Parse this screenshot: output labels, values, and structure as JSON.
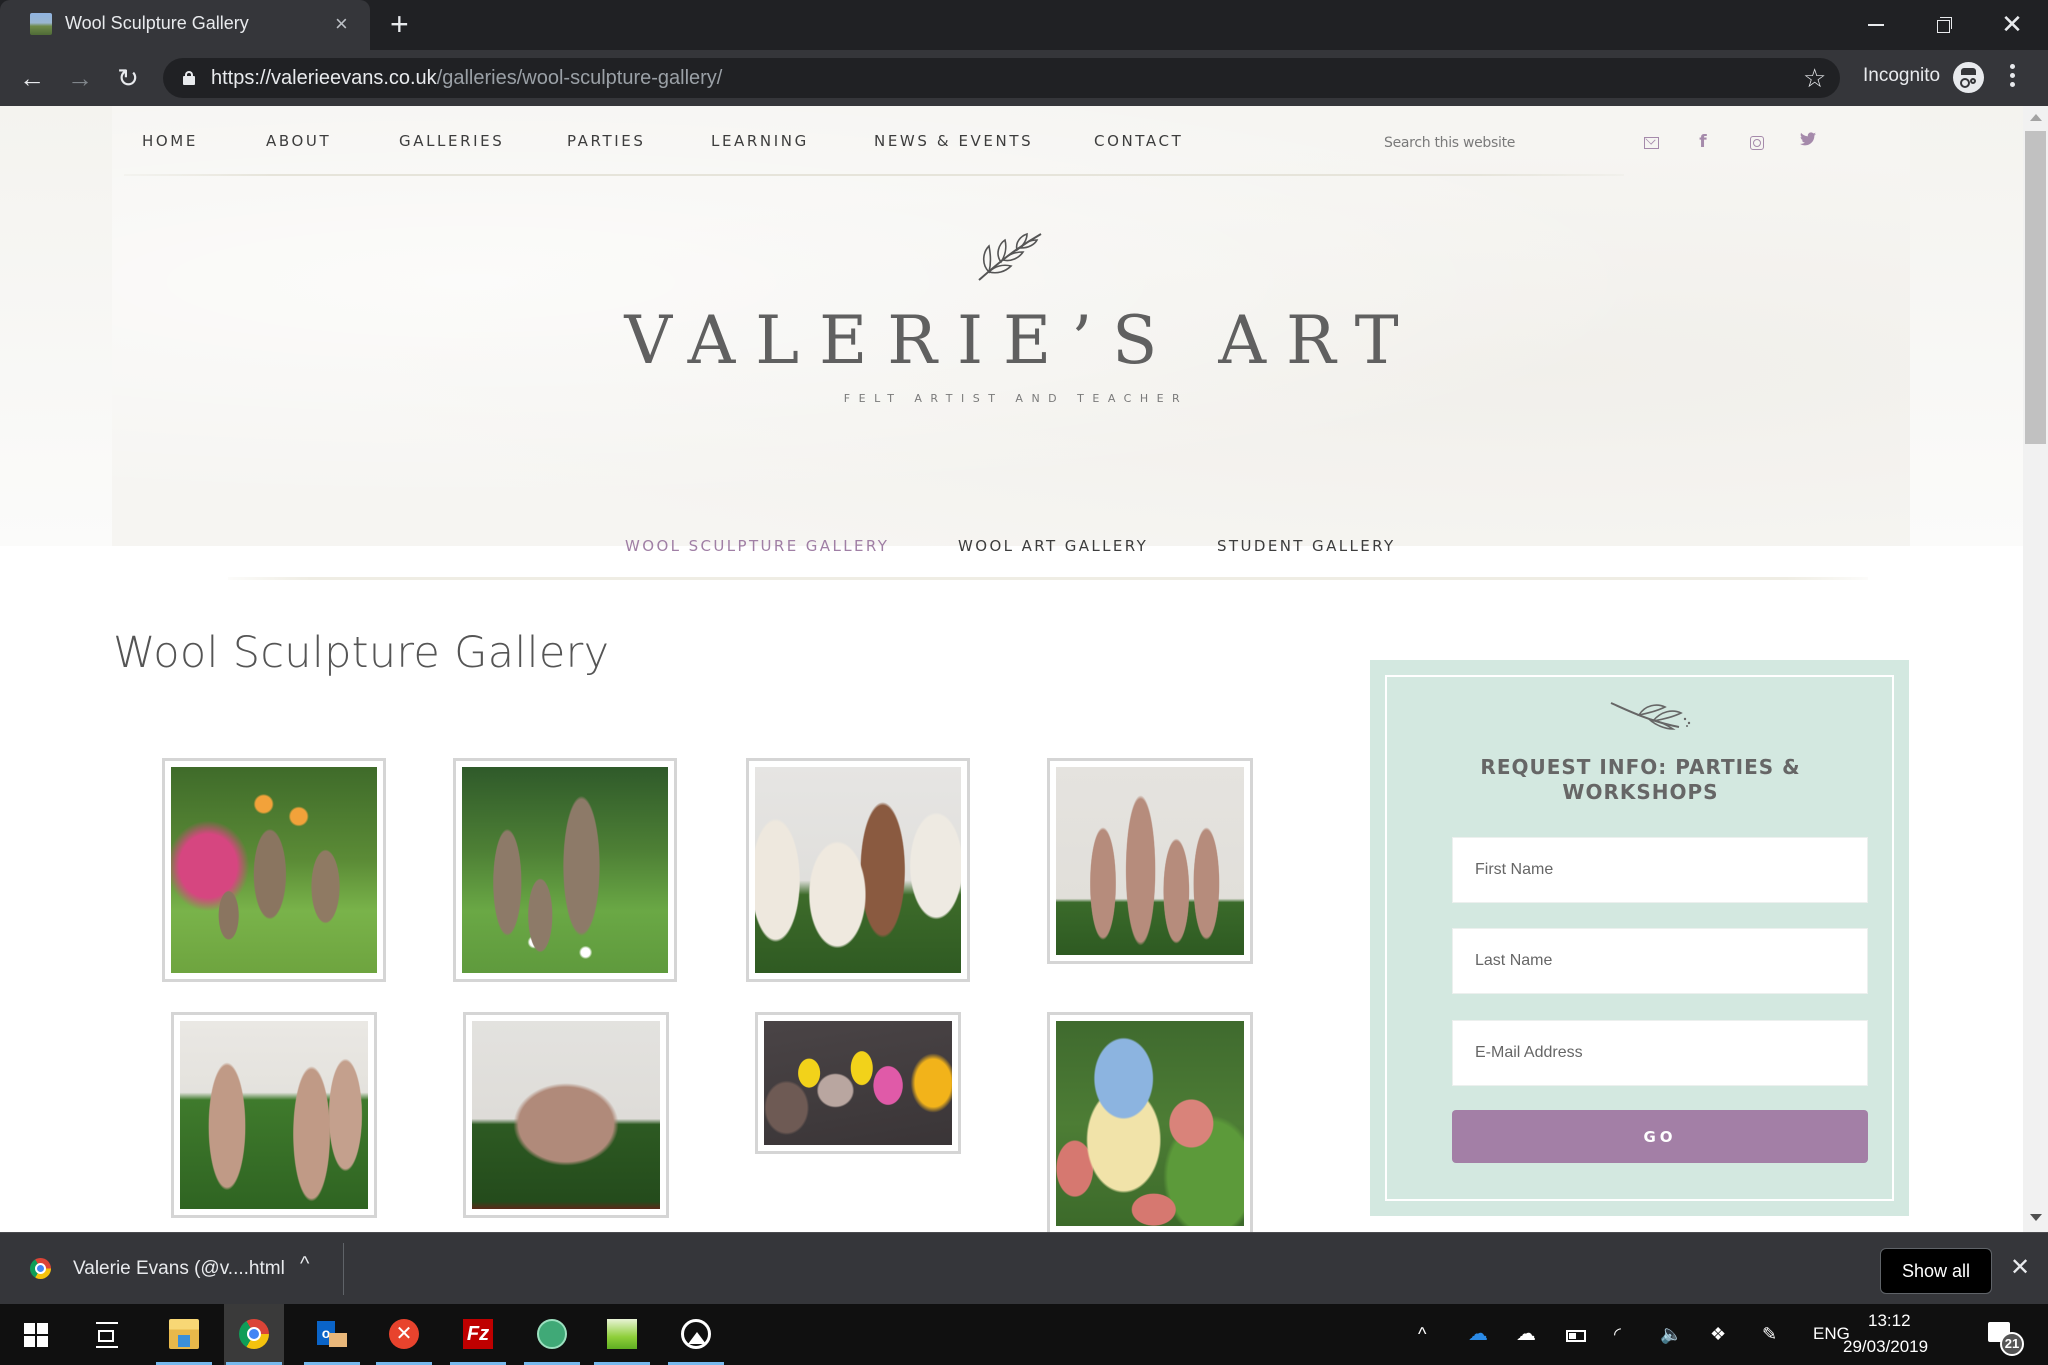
{
  "browser": {
    "tab_title": "Wool Sculpture Gallery",
    "tab_close": "×",
    "new_tab": "+",
    "url_scheme_host": "https://valerieevans.co.uk",
    "url_path": "/galleries/wool-sculpture-gallery/",
    "incognito_label": "Incognito",
    "window_close": "✕",
    "back": "←",
    "forward": "→",
    "reload": "↻",
    "bookmark_star": "☆"
  },
  "site": {
    "nav": [
      "HOME",
      "ABOUT",
      "GALLERIES",
      "PARTIES",
      "LEARNING",
      "NEWS & EVENTS",
      "CONTACT"
    ],
    "search_placeholder": "Search this website",
    "social": {
      "facebook": "f",
      "twitter": "🐦"
    },
    "title": "VALERIE’S ART",
    "tagline": "FELT ARTIST AND TEACHER",
    "accent_color": "#a07fa5",
    "gallery_nav": [
      {
        "label": "WOOL SCULPTURE GALLERY",
        "active": true
      },
      {
        "label": "WOOL ART GALLERY",
        "active": false
      },
      {
        "label": "STUDENT GALLERY",
        "active": false
      }
    ],
    "page_title": "Wool Sculpture Gallery",
    "gallery": [
      {
        "subject": "felt hares in flower garden"
      },
      {
        "subject": "felt hares among daisies"
      },
      {
        "subject": "felt sheep and ram on grass"
      },
      {
        "subject": "family of felt hares"
      },
      {
        "subject": "felt hares on artificial grass"
      },
      {
        "subject": "group of felt hares on grass"
      },
      {
        "subject": "felt chicks and hens"
      },
      {
        "subject": "felt blue tit among apples"
      }
    ]
  },
  "form": {
    "title_line1": "REQUEST INFO: PARTIES &",
    "title_line2": "WORKSHOPS",
    "first_name_placeholder": "First Name",
    "last_name_placeholder": "Last Name",
    "email_placeholder": "E-Mail Address",
    "submit_label": "GO",
    "box_color": "#d3e8e0",
    "button_color": "#a37fa6"
  },
  "downloads": {
    "file_name": "Valerie Evans (@v....html",
    "chevron": "^",
    "show_all": "Show all",
    "close": "✕"
  },
  "taskbar": {
    "apps": [
      "File Explorer",
      "Google Chrome",
      "Outlook",
      "XMind",
      "FileZilla",
      "Atom",
      "Notepad++",
      "Photos"
    ],
    "tray_chevron": "^",
    "language": "ENG",
    "time": "13:12",
    "date": "29/03/2019",
    "notification_count": "21"
  }
}
